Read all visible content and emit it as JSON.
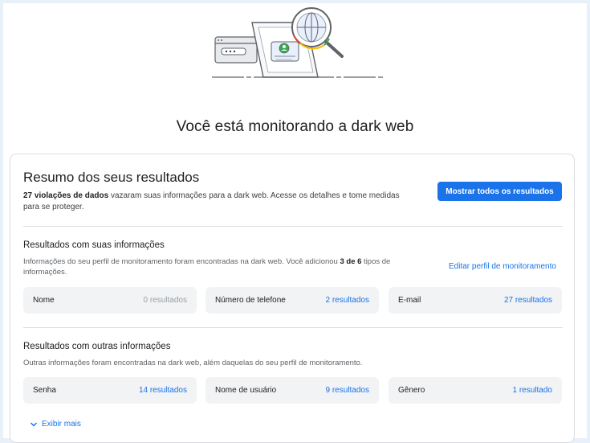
{
  "page": {
    "title": "Você está monitorando a dark web"
  },
  "summary": {
    "title": "Resumo dos seus resultados",
    "desc_bold": "27 violações de dados",
    "desc_rest": " vazaram suas informações para a dark web. Acesse os detalhes e tome medidas para se proteger.",
    "button_label": "Mostrar todos os resultados"
  },
  "own_info": {
    "title": "Resultados com suas informações",
    "desc_part1": "Informações do seu perfil de monitoramento foram encontradas na dark web. Você adicionou ",
    "desc_bold": "3 de 6",
    "desc_part2": " tipos de informações.",
    "edit_link": "Editar perfil de monitoramento",
    "tiles": [
      {
        "label": "Nome",
        "count": "0 resultados"
      },
      {
        "label": "Número de telefone",
        "count": "2 resultados"
      },
      {
        "label": "E-mail",
        "count": "27 resultados"
      }
    ]
  },
  "other_info": {
    "title": "Resultados com outras informações",
    "desc": "Outras informações foram encontradas na dark web, além daquelas do seu perfil de monitoramento.",
    "tiles": [
      {
        "label": "Senha",
        "count": "14 resultados"
      },
      {
        "label": "Nome de usuário",
        "count": "9 resultados"
      },
      {
        "label": "Gênero",
        "count": "1 resultado"
      }
    ]
  },
  "show_more": {
    "label": "Exibir mais"
  },
  "icons": {
    "hero": "dark-web-magnifier-illustration",
    "show_more": "chevron-down-icon"
  },
  "colors": {
    "accent": "#1a73e8",
    "background": "#e8f0f9",
    "tile": "#f1f3f4"
  }
}
